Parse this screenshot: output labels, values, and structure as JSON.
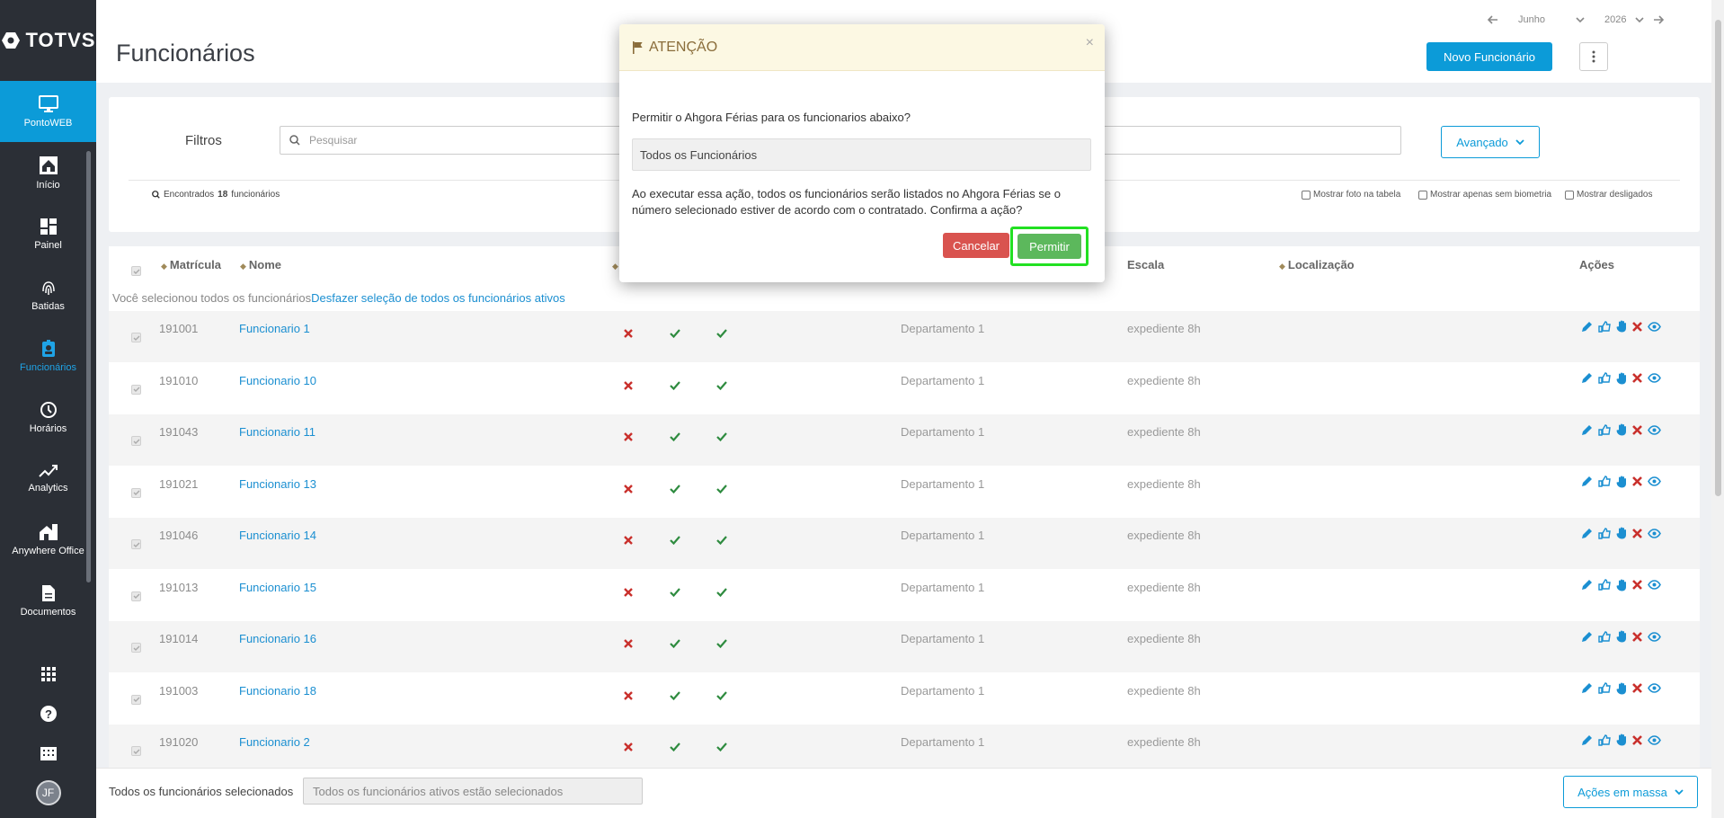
{
  "app": {
    "logo": "TOTVS"
  },
  "sidebar": {
    "items": [
      {
        "label": "PontoWEB",
        "icon": "monitor-icon"
      },
      {
        "label": "Início",
        "icon": "home-icon"
      },
      {
        "label": "Painel",
        "icon": "dashboard-icon"
      },
      {
        "label": "Batidas",
        "icon": "fingerprint-icon"
      },
      {
        "label": "Funcionários",
        "icon": "badge-icon"
      },
      {
        "label": "Horários",
        "icon": "clock-icon"
      },
      {
        "label": "Analytics",
        "icon": "trend-icon"
      },
      {
        "label": "Anywhere Office",
        "icon": "house-building-icon"
      },
      {
        "label": "Documentos",
        "icon": "document-icon"
      }
    ],
    "bottom": {
      "avatar": "JF"
    }
  },
  "header": {
    "title": "Funcionários",
    "month": "Junho",
    "year": "2026",
    "new_button": "Novo Funcionário"
  },
  "filters": {
    "label": "Filtros",
    "search_placeholder": "Pesquisar",
    "advanced": "Avançado",
    "found_prefix": "Encontrados",
    "found_count": "18",
    "found_suffix": "funcionários",
    "options": [
      "Mostrar foto na tabela",
      "Mostrar apenas sem biometria",
      "Mostrar desligados"
    ]
  },
  "table": {
    "columns": {
      "matricula": "Matrícula",
      "nome": "Nome",
      "escala": "Escala",
      "localizacao": "Localização",
      "acoes": "Ações"
    },
    "selection_note": "Você selecionou todos os funcionários",
    "undo_link": "Desfazer seleção de todos os funcionários ativos",
    "rows": [
      {
        "matricula": "191001",
        "nome": "Funcionario 1",
        "departamento": "Departamento 1",
        "escala": "expediente 8h"
      },
      {
        "matricula": "191010",
        "nome": "Funcionario 10",
        "departamento": "Departamento 1",
        "escala": "expediente 8h"
      },
      {
        "matricula": "191043",
        "nome": "Funcionario 11",
        "departamento": "Departamento 1",
        "escala": "expediente 8h"
      },
      {
        "matricula": "191021",
        "nome": "Funcionario 13",
        "departamento": "Departamento 1",
        "escala": "expediente 8h"
      },
      {
        "matricula": "191046",
        "nome": "Funcionario 14",
        "departamento": "Departamento 1",
        "escala": "expediente 8h"
      },
      {
        "matricula": "191013",
        "nome": "Funcionario 15",
        "departamento": "Departamento 1",
        "escala": "expediente 8h"
      },
      {
        "matricula": "191014",
        "nome": "Funcionario 16",
        "departamento": "Departamento 1",
        "escala": "expediente 8h"
      },
      {
        "matricula": "191003",
        "nome": "Funcionario 18",
        "departamento": "Departamento 1",
        "escala": "expediente 8h"
      },
      {
        "matricula": "191020",
        "nome": "Funcionario 2",
        "departamento": "Departamento 1",
        "escala": "expediente 8h"
      }
    ]
  },
  "footer": {
    "label": "Todos os funcionários selecionados",
    "input_value": "Todos os funcionários ativos estão selecionados",
    "mass_actions": "Ações em massa"
  },
  "modal": {
    "title": "ATENÇÃO",
    "close": "×",
    "question": "Permitir o Ahgora Férias para os funcionarios abaixo?",
    "field_value": "Todos os Funcionários",
    "message": "Ao executar essa ação, todos os funcionários serão listados no Ahgora Férias se o número selecionado estiver de acordo com o contratado. Confirma a ação?",
    "cancel": "Cancelar",
    "confirm": "Permitir"
  },
  "colors": {
    "primary": "#0c9bd8",
    "danger": "#d9534f",
    "success": "#5cb85c",
    "warning_bg": "#fcf8e3",
    "highlight": "#22e022"
  }
}
